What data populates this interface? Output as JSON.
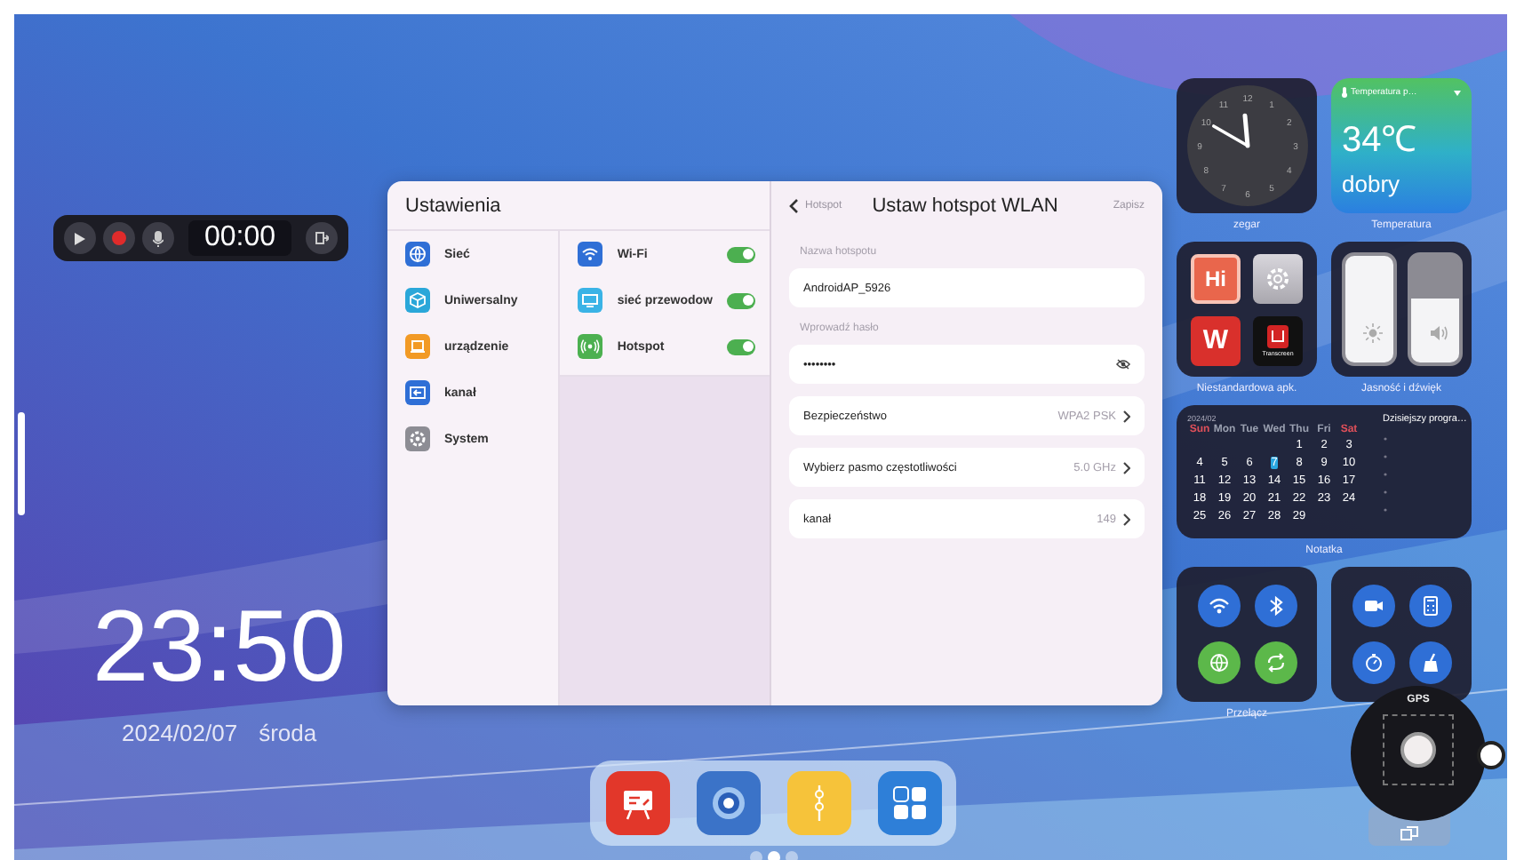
{
  "recorder": {
    "time": "00:00"
  },
  "clock": {
    "time": "23:50",
    "date": "2024/02/07",
    "weekday": "środa"
  },
  "settings": {
    "title": "Ustawienia",
    "categories": [
      {
        "label": "Sieć",
        "color": "#2f6fd6"
      },
      {
        "label": "Uniwersalny",
        "color": "#2aa7d9"
      },
      {
        "label": "urządzenie",
        "color": "#f29a25"
      },
      {
        "label": "kanał",
        "color": "#2f6fd6"
      },
      {
        "label": "System",
        "color": "#8d8d94"
      }
    ],
    "network": [
      {
        "label": "Wi-Fi",
        "color": "#2f6fd6",
        "on": true
      },
      {
        "label": "sieć przewodow",
        "color": "#3ab3e6",
        "on": true
      },
      {
        "label": "Hotspot",
        "color": "#4cb050",
        "on": true
      }
    ],
    "hotspot": {
      "back": "Hotspot",
      "title": "Ustaw hotspot WLAN",
      "action": "Zapisz",
      "name_label": "Nazwa hotspotu",
      "name_value": "AndroidAP_5926",
      "password_label": "Wprowadź hasło",
      "password_value": "••••••••",
      "options": [
        {
          "label": "Bezpieczeństwo",
          "value": "WPA2 PSK"
        },
        {
          "label": "Wybierz pasmo częstotliwości",
          "value": "5.0 GHz"
        },
        {
          "label": "kanał",
          "value": "149"
        }
      ]
    }
  },
  "widgets": {
    "clock": {
      "label": "zegar",
      "dial": [
        "12",
        "1",
        "2",
        "3",
        "4",
        "5",
        "6",
        "7",
        "8",
        "9",
        "10",
        "11"
      ]
    },
    "weather": {
      "header": "Temperatura p…",
      "temperature": "34℃",
      "condition": "dobry",
      "label": "Temperatura"
    },
    "apps": {
      "label": "Niestandardowa apk.",
      "items": [
        {
          "kind": "hi",
          "text": "Hi"
        },
        {
          "kind": "settings"
        },
        {
          "kind": "wps",
          "text": "W"
        },
        {
          "kind": "transcreen",
          "caption": "Transcreen"
        }
      ]
    },
    "brightness_sound": {
      "label": "Jasność i dźwięk",
      "brightness": {
        "level": 1
      },
      "volume": {
        "level": 0.6
      }
    },
    "calendar": {
      "month": "2024/02",
      "label": "Notatka",
      "agenda": "Dzisiejszy progra…",
      "weekdays": [
        {
          "label": "Sun",
          "color": "#e0505a"
        },
        {
          "label": "Mon",
          "color": "#9aa0b0"
        },
        {
          "label": "Tue",
          "color": "#9aa0b0"
        },
        {
          "label": "Wed",
          "color": "#9aa0b0"
        },
        {
          "label": "Thu",
          "color": "#9aa0b0"
        },
        {
          "label": "Fri",
          "color": "#9aa0b0"
        },
        {
          "label": "Sat",
          "color": "#e0505a"
        }
      ],
      "weeks": [
        [
          {
            "day": "1",
            "selected": false
          },
          {
            "day": "2",
            "selected": false
          },
          {
            "day": "3",
            "selected": false
          }
        ],
        [
          {
            "day": "4",
            "selected": false
          },
          {
            "day": "5",
            "selected": false
          },
          {
            "day": "6",
            "selected": false
          },
          {
            "day": "7",
            "selected": true
          },
          {
            "day": "8",
            "selected": false
          },
          {
            "day": "9",
            "selected": false
          },
          {
            "day": "10",
            "selected": false
          }
        ],
        [
          {
            "day": "11",
            "selected": false
          },
          {
            "day": "12",
            "selected": false
          },
          {
            "day": "13",
            "selected": false
          },
          {
            "day": "14",
            "selected": false
          },
          {
            "day": "15",
            "selected": false
          },
          {
            "day": "16",
            "selected": false
          },
          {
            "day": "17",
            "selected": false
          }
        ],
        [
          {
            "day": "18",
            "selected": false
          },
          {
            "day": "19",
            "selected": false
          },
          {
            "day": "20",
            "selected": false
          },
          {
            "day": "21",
            "selected": false
          },
          {
            "day": "22",
            "selected": false
          },
          {
            "day": "23",
            "selected": false
          },
          {
            "day": "24",
            "selected": false
          }
        ],
        [
          {
            "day": "25",
            "selected": false
          },
          {
            "day": "26",
            "selected": false
          },
          {
            "day": "27",
            "selected": false
          },
          {
            "day": "28",
            "selected": false
          },
          {
            "day": "29",
            "selected": false
          }
        ]
      ]
    },
    "toggles": {
      "label": "Przełącz",
      "items": [
        {
          "color": "#2f6fd6"
        },
        {
          "color": "#2f6fd6"
        },
        {
          "color": "#5cb84a"
        },
        {
          "color": "#5cb84a"
        }
      ]
    }
  },
  "gps": {
    "title": "GPS"
  },
  "page_dots": [
    {
      "selected": false
    },
    {
      "selected": true
    },
    {
      "selected": false
    }
  ]
}
